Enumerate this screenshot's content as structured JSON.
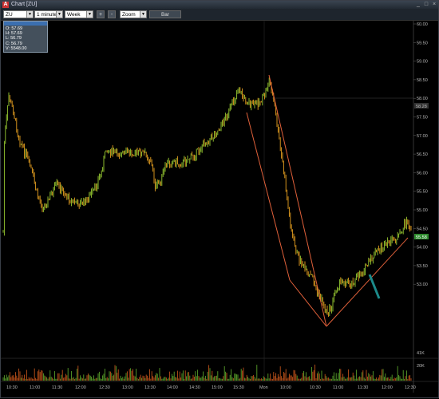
{
  "window": {
    "title": "Chart [ZU]",
    "icon": "chart-app-icon"
  },
  "toolbar": {
    "symbol": "ZU",
    "interval": "1 minute",
    "period": "Week",
    "plus_label": "+",
    "minus_label": "-",
    "zoom": "Zoom",
    "bar_label": "Bar"
  },
  "ohlc_box": {
    "header": "",
    "open": "O: 57.69",
    "high": "H: 57.69",
    "low": "L: 56.79",
    "close": "C: 56.79",
    "volume": "V: 5548.00"
  },
  "price_axis": [
    "60.00",
    "59.50",
    "59.00",
    "58.50",
    "58.00",
    "57.50",
    "57.00",
    "56.50",
    "56.00",
    "55.50",
    "55.00",
    "54.50",
    "54.00",
    "53.50",
    "53.00"
  ],
  "price_tags": {
    "crosshair": "58.28",
    "last": "55.58"
  },
  "volume_axis": [
    "41K",
    "20K"
  ],
  "time_axis": [
    "10:30",
    "11:00",
    "11:30",
    "12:00",
    "12:30",
    "13:00",
    "13:30",
    "14:00",
    "14:30",
    "15:00",
    "15:30",
    "Mon",
    "10:00",
    "10:30",
    "11:00",
    "11:30",
    "12:00",
    "12:30"
  ],
  "colors": {
    "up": "#9acd32",
    "down": "#e8a020",
    "trend": "#e0603a",
    "arrow": "#1c8a8a",
    "background": "#000000"
  }
}
